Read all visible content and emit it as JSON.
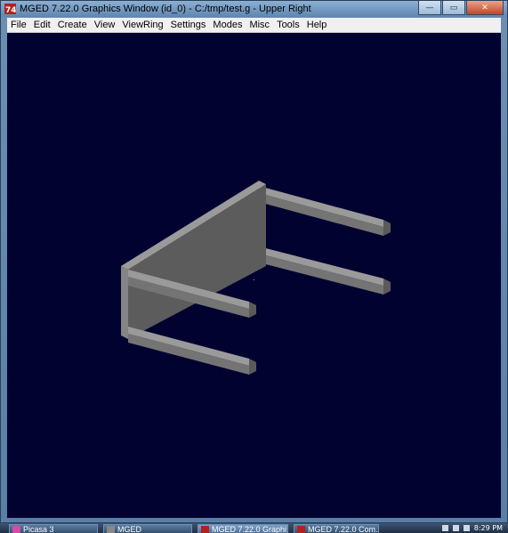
{
  "window": {
    "title": "MGED 7.22.0 Graphics Window (id_0) - C:/tmp/test.g - Upper Right",
    "controls": {
      "minimize": "—",
      "maximize": "▭",
      "close": "✕"
    }
  },
  "menu": {
    "items": [
      "File",
      "Edit",
      "Create",
      "View",
      "ViewRing",
      "Settings",
      "Modes",
      "Misc",
      "Tools",
      "Help"
    ]
  },
  "viewport": {
    "background_color": "#020231",
    "model_face_color": "#5c5c5c",
    "model_top_color": "#9a9a9a",
    "model_side_color": "#747474"
  },
  "taskbar": {
    "buttons": [
      {
        "label": "Picasa 3",
        "icon": "picasa-icon"
      },
      {
        "label": "MGED",
        "icon": "mged-icon"
      },
      {
        "label": "MGED 7.22.0 Graphi...",
        "icon": "mged-icon"
      },
      {
        "label": "MGED 7.22.0 Com...",
        "icon": "mged-icon"
      }
    ],
    "clock": "8:29 PM"
  }
}
